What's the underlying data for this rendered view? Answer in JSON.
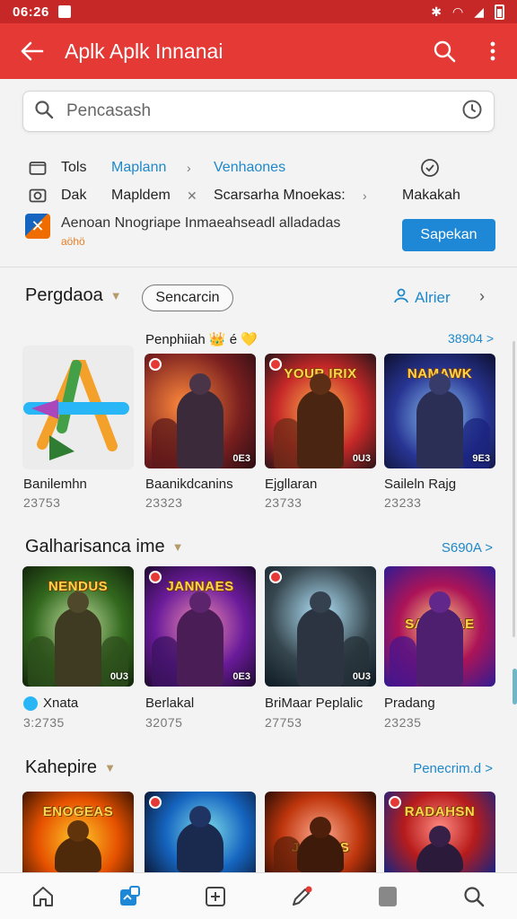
{
  "status": {
    "time": "06:26"
  },
  "app_bar": {
    "title": "Aplk Aplk Innanai"
  },
  "search": {
    "placeholder": "Pencasash"
  },
  "filters": {
    "row1": {
      "col1": "Tols",
      "col2": "Maplann",
      "col3": "Venhaones"
    },
    "row2": {
      "col1": "Dak",
      "col2": "Mapldem",
      "col3": "Scarsarha Mnoekas:",
      "col4": "Makakah"
    }
  },
  "promo": {
    "text": "Aenoan Nnogriape Inmaeahseadl alladadas",
    "sub": "aöhö",
    "button": "Sapekan"
  },
  "section1": {
    "title": "Pergdaoa",
    "pill": "Sencarcin",
    "alt_link": "Alrier",
    "subhead": "Penphiiah 👑 é 💛",
    "subhead_more": "38904 >",
    "items": [
      {
        "label": "Banilemhn",
        "count": "23753",
        "badge": ""
      },
      {
        "label": "Baanikdcanins",
        "count": "23323",
        "badge": "0E3"
      },
      {
        "label": "Ejgllaran",
        "count": "23733",
        "badge": "0U3",
        "word": "YOUR IRIX"
      },
      {
        "label": "Saileln Rajg",
        "count": "23233",
        "badge": "9E3",
        "word": "NAMAWK"
      }
    ]
  },
  "section2": {
    "title": "Galharisanca ime",
    "more": "S690A >",
    "items": [
      {
        "label": "Xnata",
        "count": "3:2735",
        "badge": "0U3",
        "word": "NENDUS"
      },
      {
        "label": "Berlakal",
        "count": "32075",
        "badge": "0E3",
        "word": "JANNAES"
      },
      {
        "label": "BriMaar Peplalic",
        "count": "27753",
        "badge": "0U3",
        "word": ""
      },
      {
        "label": "Pradang",
        "count": "23235",
        "badge": "",
        "word": "SAMAPAE"
      }
    ]
  },
  "section3": {
    "title": "Kahepire",
    "more": "Penecrim.d >",
    "items": [
      {
        "word": "ENOGEAS"
      },
      {
        "word": ""
      },
      {
        "word": "JANNAS"
      },
      {
        "word": "RADAHSN"
      }
    ]
  },
  "colors": {
    "status_bar": "#c62828",
    "app_bar": "#e53935",
    "accent_blue": "#1e88c9",
    "button_blue": "#1e88d6"
  },
  "icons": [
    "back-arrow-icon",
    "search-icon",
    "more-vert-icon",
    "history-icon",
    "folder-icon",
    "camera-icon",
    "shield-icon",
    "home-icon",
    "apps-icon",
    "add-box-icon",
    "edit-icon",
    "square-icon",
    "search-icon"
  ]
}
